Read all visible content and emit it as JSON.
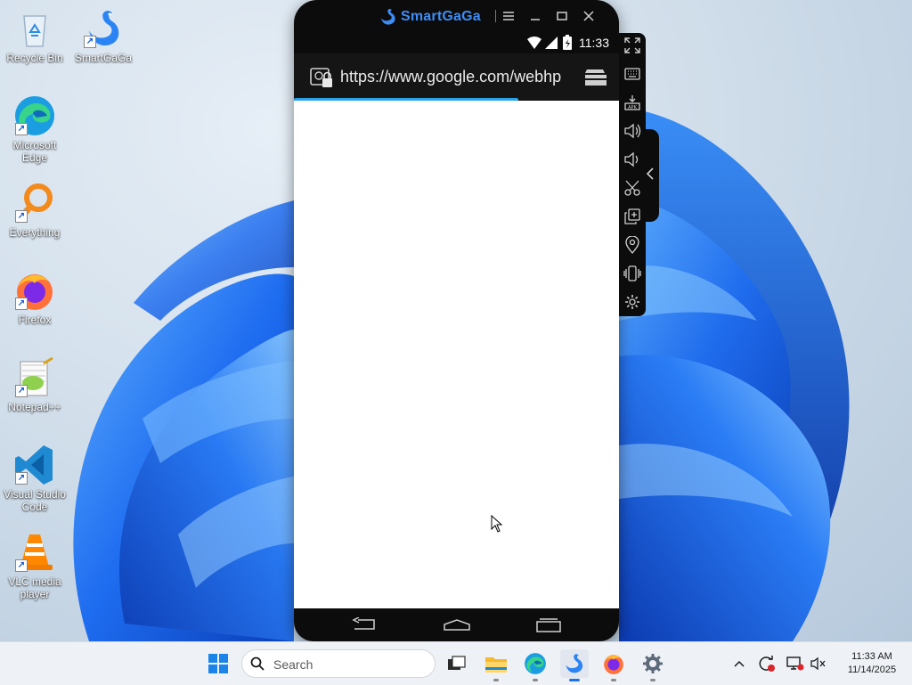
{
  "desktop": {
    "icons": [
      {
        "label": "Recycle Bin",
        "icon": "recycle-bin-icon"
      },
      {
        "label": "SmartGaGa",
        "icon": "smartgaga-swan-icon"
      },
      {
        "label": "Microsoft Edge",
        "icon": "edge-icon"
      },
      {
        "label": "Everything",
        "icon": "everything-search-icon"
      },
      {
        "label": "Firefox",
        "icon": "firefox-icon"
      },
      {
        "label": "Notepad++",
        "icon": "notepadpp-icon"
      },
      {
        "label": "Visual Studio Code",
        "icon": "vscode-icon"
      },
      {
        "label": "VLC media player",
        "icon": "vlc-icon"
      }
    ]
  },
  "emulator": {
    "app_name": "SmartGaGa",
    "brand_color": "#3e8df5",
    "status_bar": {
      "time": "11:33",
      "icons": [
        "wifi-icon",
        "signal-icon",
        "battery-icon"
      ]
    },
    "browser": {
      "url": "https://www.google.com/webhp",
      "page_load_progress": 0.69,
      "accent_color": "#27a3ea"
    },
    "titlebar_buttons": [
      "menu-icon",
      "minimize-icon",
      "maximize-icon",
      "close-icon"
    ],
    "side_toolbar": [
      "fullscreen-icon",
      "keyboard-icon",
      "install-apk-icon",
      "volume-up-icon",
      "volume-down-icon",
      "screenshot-scissors-icon",
      "multi-instance-icon",
      "location-icon",
      "shake-icon",
      "settings-gear-icon"
    ],
    "nav_buttons": [
      "back-icon",
      "home-icon",
      "recents-icon"
    ]
  },
  "taskbar": {
    "search_placeholder": "Search",
    "apps": [
      "start-icon",
      "search-icon",
      "task-view-icon",
      "file-explorer-icon",
      "edge-icon",
      "smartgaga-icon",
      "firefox-icon",
      "settings-icon"
    ],
    "active_app": "smartgaga-icon",
    "tray": {
      "time": "11:33 AM",
      "date": "11/14/2025"
    }
  }
}
